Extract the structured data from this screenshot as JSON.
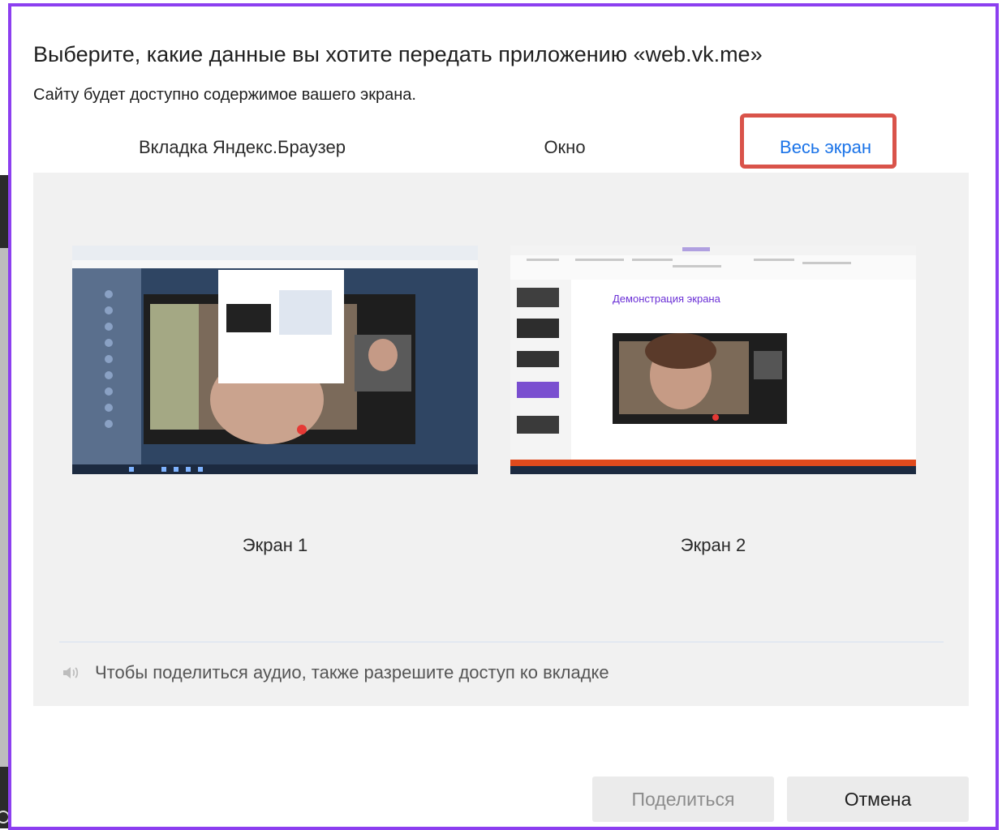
{
  "dialog": {
    "title": "Выберите, какие данные вы хотите передать приложению «web.vk.me»",
    "subtitle": "Сайту будет доступно содержимое вашего экрана."
  },
  "tabs": [
    {
      "label": "Вкладка Яндекс.Браузер",
      "selected": false
    },
    {
      "label": "Окно",
      "selected": false
    },
    {
      "label": "Весь экран",
      "selected": true
    }
  ],
  "screens": [
    {
      "label": "Экран 1"
    },
    {
      "label": "Экран 2",
      "slide_title": "Демонстрация экрана"
    }
  ],
  "audio": {
    "icon": "speaker-icon",
    "text": "Чтобы поделиться аудио, также разрешите доступ ко вкладке"
  },
  "buttons": {
    "share": "Поделиться",
    "cancel": "Отмена"
  },
  "colors": {
    "accent": "#1a73e8",
    "dialog_border": "#8c3ff0",
    "highlight": "#d9534a"
  }
}
